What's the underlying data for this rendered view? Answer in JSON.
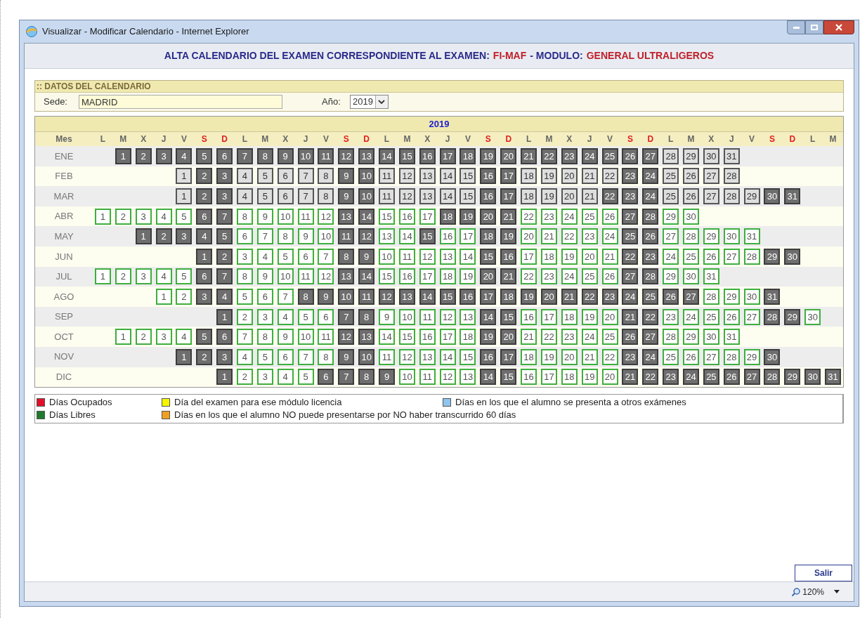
{
  "window": {
    "title": "Visualizar - Modificar Calendario - Internet Explorer"
  },
  "heading": {
    "parts": [
      {
        "text": "ALTA CALENDARIO DEL EXAMEN CORRESPONDIENTE AL EXAMEN:",
        "highlight": false
      },
      {
        "text": "FI-MAF",
        "highlight": true
      },
      {
        "text": "- MODULO:",
        "highlight": false
      },
      {
        "text": "GENERAL ULTRALIGEROS",
        "highlight": true
      }
    ]
  },
  "datos": {
    "title": ":: DATOS DEL CALENDARIO",
    "sede_label": "Sede:",
    "sede_value": "MADRID",
    "year_label": "Año:",
    "year_value": "2019"
  },
  "calendar": {
    "title": "2019",
    "month_header": "Mes",
    "weekdays": [
      {
        "label": "L",
        "weekend": false
      },
      {
        "label": "M",
        "weekend": false
      },
      {
        "label": "X",
        "weekend": false
      },
      {
        "label": "J",
        "weekend": false
      },
      {
        "label": "V",
        "weekend": false
      },
      {
        "label": "S",
        "weekend": true
      },
      {
        "label": "D",
        "weekend": true
      },
      {
        "label": "L",
        "weekend": false
      },
      {
        "label": "M",
        "weekend": false
      },
      {
        "label": "X",
        "weekend": false
      },
      {
        "label": "J",
        "weekend": false
      },
      {
        "label": "V",
        "weekend": false
      },
      {
        "label": "S",
        "weekend": true
      },
      {
        "label": "D",
        "weekend": true
      },
      {
        "label": "L",
        "weekend": false
      },
      {
        "label": "M",
        "weekend": false
      },
      {
        "label": "X",
        "weekend": false
      },
      {
        "label": "J",
        "weekend": false
      },
      {
        "label": "V",
        "weekend": false
      },
      {
        "label": "S",
        "weekend": true
      },
      {
        "label": "D",
        "weekend": true
      },
      {
        "label": "L",
        "weekend": false
      },
      {
        "label": "M",
        "weekend": false
      },
      {
        "label": "X",
        "weekend": false
      },
      {
        "label": "J",
        "weekend": false
      },
      {
        "label": "V",
        "weekend": false
      },
      {
        "label": "S",
        "weekend": true
      },
      {
        "label": "D",
        "weekend": true
      },
      {
        "label": "L",
        "weekend": false
      },
      {
        "label": "M",
        "weekend": false
      },
      {
        "label": "X",
        "weekend": false
      },
      {
        "label": "J",
        "weekend": false
      },
      {
        "label": "V",
        "weekend": false
      },
      {
        "label": "S",
        "weekend": true
      },
      {
        "label": "D",
        "weekend": true
      },
      {
        "label": "L",
        "weekend": false
      },
      {
        "label": "M",
        "weekend": false
      }
    ],
    "months": [
      {
        "name": "ENE",
        "cells": [
          {
            "kind": "empty"
          },
          {
            "day": "1",
            "kind": "blocked"
          },
          {
            "day": "2",
            "kind": "blocked"
          },
          {
            "day": "3",
            "kind": "blocked"
          },
          {
            "day": "4",
            "kind": "blocked"
          },
          {
            "day": "5",
            "kind": "blocked"
          },
          {
            "day": "6",
            "kind": "blocked"
          },
          {
            "day": "7",
            "kind": "blocked"
          },
          {
            "day": "8",
            "kind": "blocked"
          },
          {
            "day": "9",
            "kind": "blocked"
          },
          {
            "day": "10",
            "kind": "blocked"
          },
          {
            "day": "11",
            "kind": "blocked"
          },
          {
            "day": "12",
            "kind": "blocked"
          },
          {
            "day": "13",
            "kind": "blocked"
          },
          {
            "day": "14",
            "kind": "blocked"
          },
          {
            "day": "15",
            "kind": "blocked"
          },
          {
            "day": "16",
            "kind": "blocked"
          },
          {
            "day": "17",
            "kind": "blocked"
          },
          {
            "day": "18",
            "kind": "blocked"
          },
          {
            "day": "19",
            "kind": "blocked"
          },
          {
            "day": "20",
            "kind": "blocked"
          },
          {
            "day": "21",
            "kind": "blocked"
          },
          {
            "day": "22",
            "kind": "blocked"
          },
          {
            "day": "23",
            "kind": "blocked"
          },
          {
            "day": "24",
            "kind": "blocked"
          },
          {
            "day": "25",
            "kind": "blocked"
          },
          {
            "day": "26",
            "kind": "blocked"
          },
          {
            "day": "27",
            "kind": "blocked"
          },
          {
            "day": "28",
            "kind": "past"
          },
          {
            "day": "29",
            "kind": "past"
          },
          {
            "day": "30",
            "kind": "past"
          },
          {
            "day": "31",
            "kind": "past"
          }
        ]
      },
      {
        "name": "FEB",
        "cells": [
          {
            "kind": "empty"
          },
          {
            "kind": "empty"
          },
          {
            "kind": "empty"
          },
          {
            "kind": "empty"
          },
          {
            "day": "1",
            "kind": "past"
          },
          {
            "day": "2",
            "kind": "blocked"
          },
          {
            "day": "3",
            "kind": "blocked"
          },
          {
            "day": "4",
            "kind": "past"
          },
          {
            "day": "5",
            "kind": "past"
          },
          {
            "day": "6",
            "kind": "past"
          },
          {
            "day": "7",
            "kind": "past"
          },
          {
            "day": "8",
            "kind": "past"
          },
          {
            "day": "9",
            "kind": "blocked"
          },
          {
            "day": "10",
            "kind": "blocked"
          },
          {
            "day": "11",
            "kind": "past"
          },
          {
            "day": "12",
            "kind": "past"
          },
          {
            "day": "13",
            "kind": "past"
          },
          {
            "day": "14",
            "kind": "past"
          },
          {
            "day": "15",
            "kind": "past"
          },
          {
            "day": "16",
            "kind": "blocked"
          },
          {
            "day": "17",
            "kind": "blocked"
          },
          {
            "day": "18",
            "kind": "past"
          },
          {
            "day": "19",
            "kind": "past"
          },
          {
            "day": "20",
            "kind": "past"
          },
          {
            "day": "21",
            "kind": "past"
          },
          {
            "day": "22",
            "kind": "past"
          },
          {
            "day": "23",
            "kind": "blocked"
          },
          {
            "day": "24",
            "kind": "blocked"
          },
          {
            "day": "25",
            "kind": "past"
          },
          {
            "day": "26",
            "kind": "past"
          },
          {
            "day": "27",
            "kind": "past"
          },
          {
            "day": "28",
            "kind": "past"
          }
        ]
      },
      {
        "name": "MAR",
        "cells": [
          {
            "kind": "empty"
          },
          {
            "kind": "empty"
          },
          {
            "kind": "empty"
          },
          {
            "kind": "empty"
          },
          {
            "day": "1",
            "kind": "past"
          },
          {
            "day": "2",
            "kind": "blocked"
          },
          {
            "day": "3",
            "kind": "blocked"
          },
          {
            "day": "4",
            "kind": "past"
          },
          {
            "day": "5",
            "kind": "past"
          },
          {
            "day": "6",
            "kind": "past"
          },
          {
            "day": "7",
            "kind": "past"
          },
          {
            "day": "8",
            "kind": "past"
          },
          {
            "day": "9",
            "kind": "blocked"
          },
          {
            "day": "10",
            "kind": "blocked"
          },
          {
            "day": "11",
            "kind": "past"
          },
          {
            "day": "12",
            "kind": "past"
          },
          {
            "day": "13",
            "kind": "past"
          },
          {
            "day": "14",
            "kind": "past"
          },
          {
            "day": "15",
            "kind": "past"
          },
          {
            "day": "16",
            "kind": "blocked"
          },
          {
            "day": "17",
            "kind": "blocked"
          },
          {
            "day": "18",
            "kind": "past"
          },
          {
            "day": "19",
            "kind": "past"
          },
          {
            "day": "20",
            "kind": "past"
          },
          {
            "day": "21",
            "kind": "past"
          },
          {
            "day": "22",
            "kind": "blocked"
          },
          {
            "day": "23",
            "kind": "blocked"
          },
          {
            "day": "24",
            "kind": "blocked"
          },
          {
            "day": "25",
            "kind": "past"
          },
          {
            "day": "26",
            "kind": "past"
          },
          {
            "day": "27",
            "kind": "past"
          },
          {
            "day": "28",
            "kind": "past"
          },
          {
            "day": "29",
            "kind": "past"
          },
          {
            "day": "30",
            "kind": "blocked"
          },
          {
            "day": "31",
            "kind": "blocked"
          }
        ]
      },
      {
        "name": "ABR",
        "cells": [
          {
            "day": "1",
            "kind": "open"
          },
          {
            "day": "2",
            "kind": "open"
          },
          {
            "day": "3",
            "kind": "open"
          },
          {
            "day": "4",
            "kind": "open"
          },
          {
            "day": "5",
            "kind": "open"
          },
          {
            "day": "6",
            "kind": "blocked"
          },
          {
            "day": "7",
            "kind": "blocked"
          },
          {
            "day": "8",
            "kind": "open"
          },
          {
            "day": "9",
            "kind": "open"
          },
          {
            "day": "10",
            "kind": "open"
          },
          {
            "day": "11",
            "kind": "open"
          },
          {
            "day": "12",
            "kind": "open"
          },
          {
            "day": "13",
            "kind": "blocked"
          },
          {
            "day": "14",
            "kind": "blocked"
          },
          {
            "day": "15",
            "kind": "open"
          },
          {
            "day": "16",
            "kind": "open"
          },
          {
            "day": "17",
            "kind": "open"
          },
          {
            "day": "18",
            "kind": "blocked"
          },
          {
            "day": "19",
            "kind": "blocked"
          },
          {
            "day": "20",
            "kind": "blocked"
          },
          {
            "day": "21",
            "kind": "blocked"
          },
          {
            "day": "22",
            "kind": "open"
          },
          {
            "day": "23",
            "kind": "open"
          },
          {
            "day": "24",
            "kind": "open"
          },
          {
            "day": "25",
            "kind": "open"
          },
          {
            "day": "26",
            "kind": "open"
          },
          {
            "day": "27",
            "kind": "blocked"
          },
          {
            "day": "28",
            "kind": "blocked"
          },
          {
            "day": "29",
            "kind": "open"
          },
          {
            "day": "30",
            "kind": "open"
          }
        ]
      },
      {
        "name": "MAY",
        "cells": [
          {
            "kind": "empty"
          },
          {
            "kind": "empty"
          },
          {
            "day": "1",
            "kind": "blocked"
          },
          {
            "day": "2",
            "kind": "blocked"
          },
          {
            "day": "3",
            "kind": "blocked"
          },
          {
            "day": "4",
            "kind": "blocked"
          },
          {
            "day": "5",
            "kind": "blocked"
          },
          {
            "day": "6",
            "kind": "open"
          },
          {
            "day": "7",
            "kind": "open"
          },
          {
            "day": "8",
            "kind": "open"
          },
          {
            "day": "9",
            "kind": "open"
          },
          {
            "day": "10",
            "kind": "open"
          },
          {
            "day": "11",
            "kind": "blocked"
          },
          {
            "day": "12",
            "kind": "blocked"
          },
          {
            "day": "13",
            "kind": "open"
          },
          {
            "day": "14",
            "kind": "open"
          },
          {
            "day": "15",
            "kind": "blocked"
          },
          {
            "day": "16",
            "kind": "open"
          },
          {
            "day": "17",
            "kind": "open"
          },
          {
            "day": "18",
            "kind": "blocked"
          },
          {
            "day": "19",
            "kind": "blocked"
          },
          {
            "day": "20",
            "kind": "open"
          },
          {
            "day": "21",
            "kind": "open"
          },
          {
            "day": "22",
            "kind": "open"
          },
          {
            "day": "23",
            "kind": "open"
          },
          {
            "day": "24",
            "kind": "open"
          },
          {
            "day": "25",
            "kind": "blocked"
          },
          {
            "day": "26",
            "kind": "blocked"
          },
          {
            "day": "27",
            "kind": "open"
          },
          {
            "day": "28",
            "kind": "open"
          },
          {
            "day": "29",
            "kind": "open"
          },
          {
            "day": "30",
            "kind": "open"
          },
          {
            "day": "31",
            "kind": "open"
          }
        ]
      },
      {
        "name": "JUN",
        "cells": [
          {
            "kind": "empty"
          },
          {
            "kind": "empty"
          },
          {
            "kind": "empty"
          },
          {
            "kind": "empty"
          },
          {
            "kind": "empty"
          },
          {
            "day": "1",
            "kind": "blocked"
          },
          {
            "day": "2",
            "kind": "blocked"
          },
          {
            "day": "3",
            "kind": "open"
          },
          {
            "day": "4",
            "kind": "open"
          },
          {
            "day": "5",
            "kind": "open"
          },
          {
            "day": "6",
            "kind": "open"
          },
          {
            "day": "7",
            "kind": "open"
          },
          {
            "day": "8",
            "kind": "blocked"
          },
          {
            "day": "9",
            "kind": "blocked"
          },
          {
            "day": "10",
            "kind": "open"
          },
          {
            "day": "11",
            "kind": "open"
          },
          {
            "day": "12",
            "kind": "open"
          },
          {
            "day": "13",
            "kind": "open"
          },
          {
            "day": "14",
            "kind": "open"
          },
          {
            "day": "15",
            "kind": "blocked"
          },
          {
            "day": "16",
            "kind": "blocked"
          },
          {
            "day": "17",
            "kind": "open"
          },
          {
            "day": "18",
            "kind": "open"
          },
          {
            "day": "19",
            "kind": "open"
          },
          {
            "day": "20",
            "kind": "open"
          },
          {
            "day": "21",
            "kind": "open"
          },
          {
            "day": "22",
            "kind": "blocked"
          },
          {
            "day": "23",
            "kind": "blocked"
          },
          {
            "day": "24",
            "kind": "open"
          },
          {
            "day": "25",
            "kind": "open"
          },
          {
            "day": "26",
            "kind": "open"
          },
          {
            "day": "27",
            "kind": "open"
          },
          {
            "day": "28",
            "kind": "open"
          },
          {
            "day": "29",
            "kind": "blocked"
          },
          {
            "day": "30",
            "kind": "blocked"
          }
        ]
      },
      {
        "name": "JUL",
        "cells": [
          {
            "day": "1",
            "kind": "open"
          },
          {
            "day": "2",
            "kind": "open"
          },
          {
            "day": "3",
            "kind": "open"
          },
          {
            "day": "4",
            "kind": "open"
          },
          {
            "day": "5",
            "kind": "open"
          },
          {
            "day": "6",
            "kind": "blocked"
          },
          {
            "day": "7",
            "kind": "blocked"
          },
          {
            "day": "8",
            "kind": "open"
          },
          {
            "day": "9",
            "kind": "open"
          },
          {
            "day": "10",
            "kind": "open"
          },
          {
            "day": "11",
            "kind": "open"
          },
          {
            "day": "12",
            "kind": "open"
          },
          {
            "day": "13",
            "kind": "blocked"
          },
          {
            "day": "14",
            "kind": "blocked"
          },
          {
            "day": "15",
            "kind": "open"
          },
          {
            "day": "16",
            "kind": "open"
          },
          {
            "day": "17",
            "kind": "open"
          },
          {
            "day": "18",
            "kind": "open"
          },
          {
            "day": "19",
            "kind": "open"
          },
          {
            "day": "20",
            "kind": "blocked"
          },
          {
            "day": "21",
            "kind": "blocked"
          },
          {
            "day": "22",
            "kind": "open"
          },
          {
            "day": "23",
            "kind": "open"
          },
          {
            "day": "24",
            "kind": "open"
          },
          {
            "day": "25",
            "kind": "open"
          },
          {
            "day": "26",
            "kind": "open"
          },
          {
            "day": "27",
            "kind": "blocked"
          },
          {
            "day": "28",
            "kind": "blocked"
          },
          {
            "day": "29",
            "kind": "open"
          },
          {
            "day": "30",
            "kind": "open"
          },
          {
            "day": "31",
            "kind": "open"
          }
        ]
      },
      {
        "name": "AGO",
        "cells": [
          {
            "kind": "empty"
          },
          {
            "kind": "empty"
          },
          {
            "kind": "empty"
          },
          {
            "day": "1",
            "kind": "open"
          },
          {
            "day": "2",
            "kind": "open"
          },
          {
            "day": "3",
            "kind": "blocked"
          },
          {
            "day": "4",
            "kind": "blocked"
          },
          {
            "day": "5",
            "kind": "open"
          },
          {
            "day": "6",
            "kind": "open"
          },
          {
            "day": "7",
            "kind": "open"
          },
          {
            "day": "8",
            "kind": "blocked"
          },
          {
            "day": "9",
            "kind": "blocked"
          },
          {
            "day": "10",
            "kind": "blocked"
          },
          {
            "day": "11",
            "kind": "blocked"
          },
          {
            "day": "12",
            "kind": "blocked"
          },
          {
            "day": "13",
            "kind": "blocked"
          },
          {
            "day": "14",
            "kind": "blocked"
          },
          {
            "day": "15",
            "kind": "blocked"
          },
          {
            "day": "16",
            "kind": "blocked"
          },
          {
            "day": "17",
            "kind": "blocked"
          },
          {
            "day": "18",
            "kind": "blocked"
          },
          {
            "day": "19",
            "kind": "blocked"
          },
          {
            "day": "20",
            "kind": "blocked"
          },
          {
            "day": "21",
            "kind": "blocked"
          },
          {
            "day": "22",
            "kind": "blocked"
          },
          {
            "day": "23",
            "kind": "blocked"
          },
          {
            "day": "24",
            "kind": "blocked"
          },
          {
            "day": "25",
            "kind": "blocked"
          },
          {
            "day": "26",
            "kind": "blocked"
          },
          {
            "day": "27",
            "kind": "blocked"
          },
          {
            "day": "28",
            "kind": "open"
          },
          {
            "day": "29",
            "kind": "open"
          },
          {
            "day": "30",
            "kind": "open"
          },
          {
            "day": "31",
            "kind": "blocked"
          }
        ]
      },
      {
        "name": "SEP",
        "cells": [
          {
            "kind": "empty"
          },
          {
            "kind": "empty"
          },
          {
            "kind": "empty"
          },
          {
            "kind": "empty"
          },
          {
            "kind": "empty"
          },
          {
            "kind": "empty"
          },
          {
            "day": "1",
            "kind": "blocked"
          },
          {
            "day": "2",
            "kind": "open"
          },
          {
            "day": "3",
            "kind": "open"
          },
          {
            "day": "4",
            "kind": "open"
          },
          {
            "day": "5",
            "kind": "open"
          },
          {
            "day": "6",
            "kind": "open"
          },
          {
            "day": "7",
            "kind": "blocked"
          },
          {
            "day": "8",
            "kind": "blocked"
          },
          {
            "day": "9",
            "kind": "open"
          },
          {
            "day": "10",
            "kind": "open"
          },
          {
            "day": "11",
            "kind": "open"
          },
          {
            "day": "12",
            "kind": "open"
          },
          {
            "day": "13",
            "kind": "open"
          },
          {
            "day": "14",
            "kind": "blocked"
          },
          {
            "day": "15",
            "kind": "blocked"
          },
          {
            "day": "16",
            "kind": "open"
          },
          {
            "day": "17",
            "kind": "open"
          },
          {
            "day": "18",
            "kind": "open"
          },
          {
            "day": "19",
            "kind": "open"
          },
          {
            "day": "20",
            "kind": "open"
          },
          {
            "day": "21",
            "kind": "blocked"
          },
          {
            "day": "22",
            "kind": "blocked"
          },
          {
            "day": "23",
            "kind": "open"
          },
          {
            "day": "24",
            "kind": "open"
          },
          {
            "day": "25",
            "kind": "open"
          },
          {
            "day": "26",
            "kind": "open"
          },
          {
            "day": "27",
            "kind": "open"
          },
          {
            "day": "28",
            "kind": "blocked"
          },
          {
            "day": "29",
            "kind": "blocked"
          },
          {
            "day": "30",
            "kind": "open"
          }
        ]
      },
      {
        "name": "OCT",
        "cells": [
          {
            "kind": "empty"
          },
          {
            "day": "1",
            "kind": "open"
          },
          {
            "day": "2",
            "kind": "open"
          },
          {
            "day": "3",
            "kind": "open"
          },
          {
            "day": "4",
            "kind": "open"
          },
          {
            "day": "5",
            "kind": "blocked"
          },
          {
            "day": "6",
            "kind": "blocked"
          },
          {
            "day": "7",
            "kind": "open"
          },
          {
            "day": "8",
            "kind": "open"
          },
          {
            "day": "9",
            "kind": "open"
          },
          {
            "day": "10",
            "kind": "open"
          },
          {
            "day": "11",
            "kind": "open"
          },
          {
            "day": "12",
            "kind": "blocked"
          },
          {
            "day": "13",
            "kind": "blocked"
          },
          {
            "day": "14",
            "kind": "open"
          },
          {
            "day": "15",
            "kind": "open"
          },
          {
            "day": "16",
            "kind": "open"
          },
          {
            "day": "17",
            "kind": "open"
          },
          {
            "day": "18",
            "kind": "open"
          },
          {
            "day": "19",
            "kind": "blocked"
          },
          {
            "day": "20",
            "kind": "blocked"
          },
          {
            "day": "21",
            "kind": "open"
          },
          {
            "day": "22",
            "kind": "open"
          },
          {
            "day": "23",
            "kind": "open"
          },
          {
            "day": "24",
            "kind": "open"
          },
          {
            "day": "25",
            "kind": "open"
          },
          {
            "day": "26",
            "kind": "blocked"
          },
          {
            "day": "27",
            "kind": "blocked"
          },
          {
            "day": "28",
            "kind": "open"
          },
          {
            "day": "29",
            "kind": "open"
          },
          {
            "day": "30",
            "kind": "open"
          },
          {
            "day": "31",
            "kind": "open"
          }
        ]
      },
      {
        "name": "NOV",
        "cells": [
          {
            "kind": "empty"
          },
          {
            "kind": "empty"
          },
          {
            "kind": "empty"
          },
          {
            "kind": "empty"
          },
          {
            "day": "1",
            "kind": "blocked"
          },
          {
            "day": "2",
            "kind": "blocked"
          },
          {
            "day": "3",
            "kind": "blocked"
          },
          {
            "day": "4",
            "kind": "open"
          },
          {
            "day": "5",
            "kind": "open"
          },
          {
            "day": "6",
            "kind": "open"
          },
          {
            "day": "7",
            "kind": "open"
          },
          {
            "day": "8",
            "kind": "open"
          },
          {
            "day": "9",
            "kind": "blocked"
          },
          {
            "day": "10",
            "kind": "blocked"
          },
          {
            "day": "11",
            "kind": "open"
          },
          {
            "day": "12",
            "kind": "open"
          },
          {
            "day": "13",
            "kind": "open"
          },
          {
            "day": "14",
            "kind": "open"
          },
          {
            "day": "15",
            "kind": "open"
          },
          {
            "day": "16",
            "kind": "blocked"
          },
          {
            "day": "17",
            "kind": "blocked"
          },
          {
            "day": "18",
            "kind": "open"
          },
          {
            "day": "19",
            "kind": "open"
          },
          {
            "day": "20",
            "kind": "open"
          },
          {
            "day": "21",
            "kind": "open"
          },
          {
            "day": "22",
            "kind": "open"
          },
          {
            "day": "23",
            "kind": "blocked"
          },
          {
            "day": "24",
            "kind": "blocked"
          },
          {
            "day": "25",
            "kind": "open"
          },
          {
            "day": "26",
            "kind": "open"
          },
          {
            "day": "27",
            "kind": "open"
          },
          {
            "day": "28",
            "kind": "open"
          },
          {
            "day": "29",
            "kind": "open"
          },
          {
            "day": "30",
            "kind": "blocked"
          }
        ]
      },
      {
        "name": "DIC",
        "cells": [
          {
            "kind": "empty"
          },
          {
            "kind": "empty"
          },
          {
            "kind": "empty"
          },
          {
            "kind": "empty"
          },
          {
            "kind": "empty"
          },
          {
            "kind": "empty"
          },
          {
            "day": "1",
            "kind": "blocked"
          },
          {
            "day": "2",
            "kind": "open"
          },
          {
            "day": "3",
            "kind": "open"
          },
          {
            "day": "4",
            "kind": "open"
          },
          {
            "day": "5",
            "kind": "open"
          },
          {
            "day": "6",
            "kind": "blocked"
          },
          {
            "day": "7",
            "kind": "blocked"
          },
          {
            "day": "8",
            "kind": "blocked"
          },
          {
            "day": "9",
            "kind": "blocked"
          },
          {
            "day": "10",
            "kind": "open"
          },
          {
            "day": "11",
            "kind": "open"
          },
          {
            "day": "12",
            "kind": "open"
          },
          {
            "day": "13",
            "kind": "open"
          },
          {
            "day": "14",
            "kind": "blocked"
          },
          {
            "day": "15",
            "kind": "blocked"
          },
          {
            "day": "16",
            "kind": "open"
          },
          {
            "day": "17",
            "kind": "open"
          },
          {
            "day": "18",
            "kind": "open"
          },
          {
            "day": "19",
            "kind": "open"
          },
          {
            "day": "20",
            "kind": "open"
          },
          {
            "day": "21",
            "kind": "blocked"
          },
          {
            "day": "22",
            "kind": "blocked"
          },
          {
            "day": "23",
            "kind": "blocked"
          },
          {
            "day": "24",
            "kind": "blocked"
          },
          {
            "day": "25",
            "kind": "blocked"
          },
          {
            "day": "26",
            "kind": "blocked"
          },
          {
            "day": "27",
            "kind": "blocked"
          },
          {
            "day": "28",
            "kind": "blocked"
          },
          {
            "day": "29",
            "kind": "blocked"
          },
          {
            "day": "30",
            "kind": "blocked"
          },
          {
            "day": "31",
            "kind": "blocked"
          }
        ]
      }
    ]
  },
  "legend": [
    {
      "label": "Días Ocupados",
      "color": "#e0102a"
    },
    {
      "label": "Día del examen para ese módulo licencia",
      "color": "#f5f500"
    },
    {
      "label": "Días en los que el alumno se presenta a otros exámenes",
      "color": "#8ec4ee"
    },
    {
      "label": "Días Libres",
      "color": "#1e7a2c"
    },
    {
      "label": "Días en los que el alumno NO puede presentarse por NO haber transcurrido 60 días",
      "color": "#f0a020"
    }
  ],
  "buttons": {
    "exit": "Salir"
  },
  "status_bar": {
    "zoom": "120%"
  }
}
